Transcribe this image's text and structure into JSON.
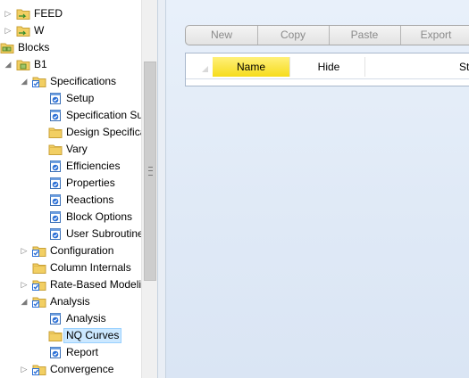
{
  "tree": {
    "items": [
      {
        "label": "FEED",
        "level": 1,
        "expander": "collapsed",
        "icon": "stream-folder-icon"
      },
      {
        "label": "W",
        "level": 1,
        "expander": "collapsed",
        "icon": "stream-folder-icon"
      },
      {
        "label": "Blocks",
        "level": 0,
        "expander": "none",
        "icon": "blocks-folder-icon"
      },
      {
        "label": "B1",
        "level": 1,
        "expander": "expanded",
        "icon": "block-folder-icon"
      },
      {
        "label": "Specifications",
        "level": 2,
        "expander": "expanded",
        "icon": "checked-folder-icon"
      },
      {
        "label": "Setup",
        "level": 3,
        "expander": "none",
        "icon": "checked-form-icon"
      },
      {
        "label": "Specification Su",
        "level": 3,
        "expander": "none",
        "icon": "checked-form-icon"
      },
      {
        "label": "Design Specifica",
        "level": 3,
        "expander": "none",
        "icon": "folder-icon"
      },
      {
        "label": "Vary",
        "level": 3,
        "expander": "none",
        "icon": "folder-icon"
      },
      {
        "label": "Efficiencies",
        "level": 3,
        "expander": "none",
        "icon": "checked-form-icon"
      },
      {
        "label": "Properties",
        "level": 3,
        "expander": "none",
        "icon": "checked-form-icon"
      },
      {
        "label": "Reactions",
        "level": 3,
        "expander": "none",
        "icon": "checked-form-icon"
      },
      {
        "label": "Block Options",
        "level": 3,
        "expander": "none",
        "icon": "checked-form-icon"
      },
      {
        "label": "User Subroutine",
        "level": 3,
        "expander": "none",
        "icon": "checked-form-icon"
      },
      {
        "label": "Configuration",
        "level": 2,
        "expander": "collapsed",
        "icon": "checked-folder-icon"
      },
      {
        "label": "Column Internals",
        "level": 2,
        "expander": "none",
        "icon": "folder-icon"
      },
      {
        "label": "Rate-Based Modelin",
        "level": 2,
        "expander": "collapsed",
        "icon": "checked-folder-icon"
      },
      {
        "label": "Analysis",
        "level": 2,
        "expander": "expanded",
        "icon": "checked-folder-icon"
      },
      {
        "label": "Analysis",
        "level": 3,
        "expander": "none",
        "icon": "checked-form-icon"
      },
      {
        "label": "NQ Curves",
        "level": 3,
        "expander": "none",
        "icon": "folder-icon",
        "selected": true
      },
      {
        "label": "Report",
        "level": 3,
        "expander": "none",
        "icon": "checked-form-icon"
      },
      {
        "label": "Convergence",
        "level": 2,
        "expander": "collapsed",
        "icon": "checked-folder-icon"
      }
    ]
  },
  "toolbar": {
    "new_label": "New",
    "copy_label": "Copy",
    "paste_label": "Paste",
    "export_label": "Export"
  },
  "grid": {
    "columns": [
      "Name",
      "Hide",
      "St"
    ]
  },
  "colors": {
    "folder_yellow": "#f2cf63",
    "check_blue": "#2a6fd6",
    "header_highlight": "#f6dc1c",
    "selection": "#cce8ff"
  }
}
